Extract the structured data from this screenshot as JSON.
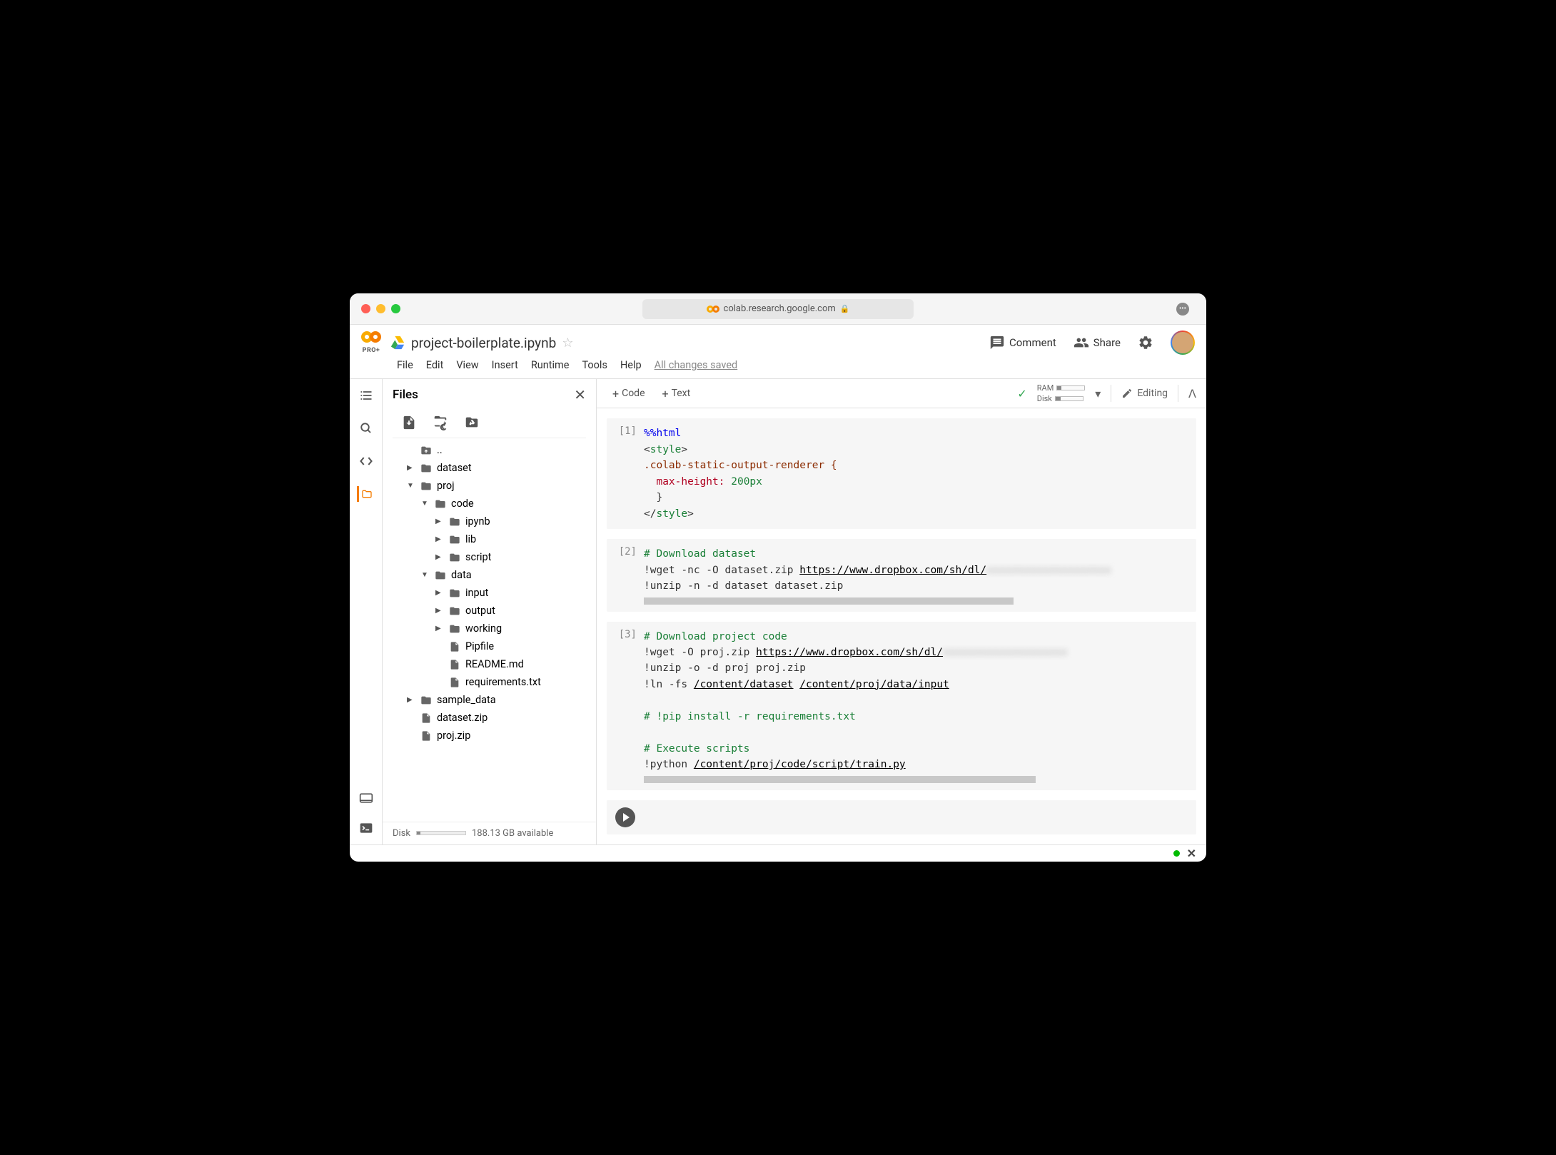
{
  "browser": {
    "url": "colab.research.google.com"
  },
  "header": {
    "logo_sub": "PRO+",
    "doc_title": "project-boilerplate.ipynb",
    "comment_label": "Comment",
    "share_label": "Share"
  },
  "menu": {
    "file": "File",
    "edit": "Edit",
    "view": "View",
    "insert": "Insert",
    "runtime": "Runtime",
    "tools": "Tools",
    "help": "Help",
    "saved_status": "All changes saved"
  },
  "sidebar": {
    "title": "Files",
    "disk_label": "Disk",
    "disk_available": "188.13 GB available",
    "tree": {
      "parent": "..",
      "dataset": "dataset",
      "proj": "proj",
      "code": "code",
      "ipynb": "ipynb",
      "lib": "lib",
      "script": "script",
      "data": "data",
      "input": "input",
      "output": "output",
      "working": "working",
      "pipfile": "Pipfile",
      "readme": "README.md",
      "requirements": "requirements.txt",
      "sample_data": "sample_data",
      "dataset_zip": "dataset.zip",
      "proj_zip": "proj.zip"
    }
  },
  "toolbar": {
    "add_code": "Code",
    "add_text": "Text",
    "ram_label": "RAM",
    "disk_label": "Disk",
    "editing_label": "Editing"
  },
  "cells": {
    "c1": {
      "num": "[1]",
      "magic": "%%html",
      "tag_open_s": "<",
      "tag_style": "style",
      "tag_open_e": ">",
      "rule": ".colab-static-output-renderer {",
      "attr": "  max-height:",
      "val": " 200px",
      "brace_close": "  }",
      "tag_close_s": "</",
      "tag_close_e": ">"
    },
    "c2": {
      "num": "[2]",
      "comment1": "# Download dataset",
      "line2_pre": "!wget -nc -O dataset.zip ",
      "line2_url": "https://www.dropbox.com/sh/dl/",
      "line2_blur": "xxxxxxxxxxxxxxxxxxxx",
      "line3": "!unzip -n -d dataset dataset.zip"
    },
    "c3": {
      "num": "[3]",
      "comment1": "# Download project code",
      "line2_pre": "!wget -O proj.zip ",
      "line2_url": "https://www.dropbox.com/sh/dl/",
      "line2_blur": "xxxxxxxxxxxxxxxxxxxx",
      "line3": "!unzip -o -d proj proj.zip",
      "line4_pre": "!ln -fs ",
      "line4_p1": "/content/dataset",
      "line4_mid": " ",
      "line4_p2": "/content/proj/data/input",
      "comment2": "# !pip install -r requirements.txt",
      "comment3": "# Execute scripts",
      "line8_pre": "!python ",
      "line8_path": "/content/proj/code/script/train.py"
    }
  }
}
